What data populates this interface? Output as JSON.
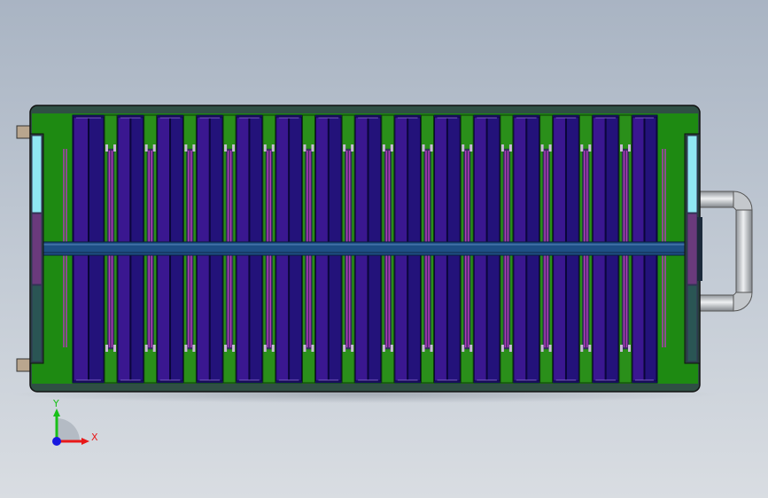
{
  "scene": {
    "view": "top",
    "colors": {
      "background_top": "#a9b4c3",
      "background_bottom": "#d9dde2",
      "frame_green": "#1e8a12",
      "frame_dark": "#2f4f44",
      "cell_blue": "#23127a",
      "cell_purple": "#3a1790",
      "separator_green": "#2a8f1a",
      "rail_blue": "#1e4f85",
      "end_cap_cyan": "#8fe8f2",
      "end_cap_purple": "#6a3a7c",
      "end_cap_teal": "#2a5554",
      "handle_gray": "#c9cdd1"
    },
    "cell_stack": {
      "separator_count": 14,
      "cells_per_gap": 2
    },
    "handle": {
      "side": "right",
      "icon": "pipe-handle-icon"
    }
  },
  "triad": {
    "y_label": "Y",
    "x_label": "X",
    "colors": {
      "x": "#e81818",
      "y": "#18c018",
      "z": "#1818e0"
    }
  }
}
